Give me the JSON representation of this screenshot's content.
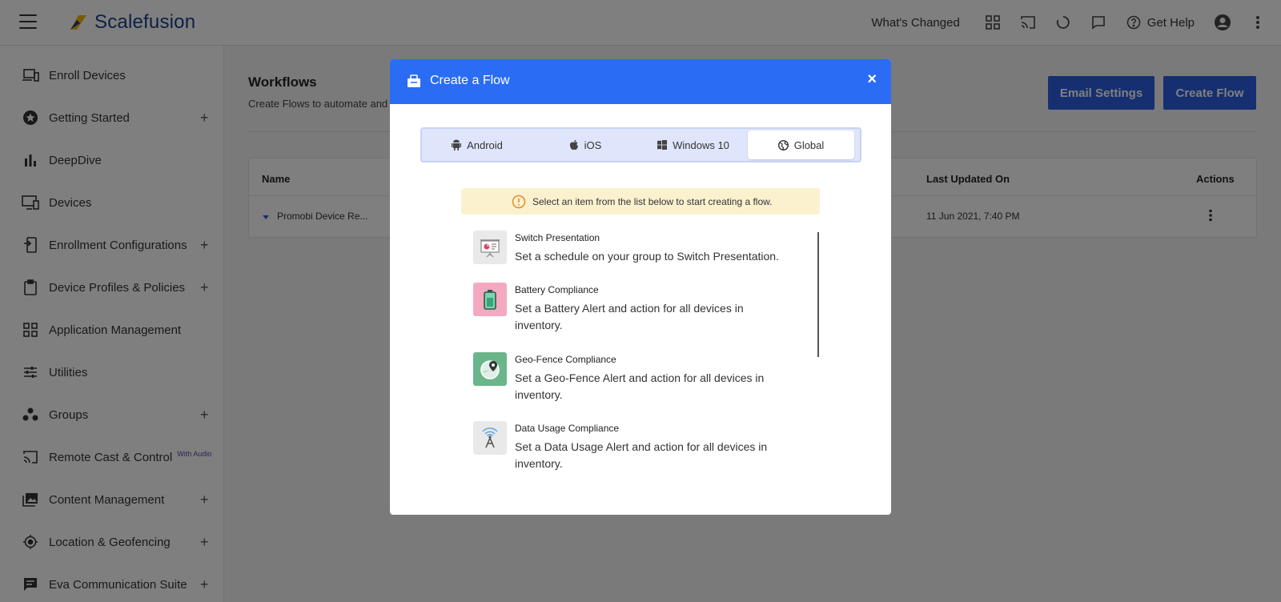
{
  "header": {
    "brand": "Scalefusion",
    "whats_changed": "What's Changed",
    "get_help": "Get Help"
  },
  "sidebar": {
    "items": [
      {
        "label": "Enroll Devices",
        "icon": "devices-icon",
        "expandable": false
      },
      {
        "label": "Getting Started",
        "icon": "star-icon",
        "expandable": true
      },
      {
        "label": "DeepDive",
        "icon": "bar-chart-icon",
        "expandable": false
      },
      {
        "label": "Devices",
        "icon": "monitor-icon",
        "expandable": false
      },
      {
        "label": "Enrollment Configurations",
        "icon": "phone-config-icon",
        "expandable": true
      },
      {
        "label": "Device Profiles & Policies",
        "icon": "clipboard-icon",
        "expandable": true
      },
      {
        "label": "Application Management",
        "icon": "apps-grid-icon",
        "expandable": false
      },
      {
        "label": "Utilities",
        "icon": "sliders-icon",
        "expandable": false
      },
      {
        "label": "Groups",
        "icon": "groups-icon",
        "expandable": true
      },
      {
        "label": "Remote Cast & Control",
        "icon": "cast-icon",
        "expandable": false,
        "sup": "With Audio"
      },
      {
        "label": "Content Management",
        "icon": "photo-library-icon",
        "expandable": true
      },
      {
        "label": "Location & Geofencing",
        "icon": "location-icon",
        "expandable": true
      },
      {
        "label": "Eva Communication Suite",
        "icon": "chat-icon",
        "expandable": true
      }
    ]
  },
  "main": {
    "title": "Workflows",
    "subtitle": "Create Flows to automate and s",
    "email_settings": "Email Settings",
    "create_flow": "Create Flow",
    "table": {
      "headers": {
        "name": "Name",
        "last_updated": "Last Updated On",
        "actions": "Actions"
      },
      "rows": [
        {
          "name": "Promobi Device Re...",
          "last_updated": "11 Jun 2021, 7:40 PM"
        }
      ]
    }
  },
  "modal": {
    "title": "Create a Flow",
    "close": "×",
    "tabs": [
      {
        "label": "Android",
        "icon": "android-icon"
      },
      {
        "label": "iOS",
        "icon": "apple-icon"
      },
      {
        "label": "Windows 10",
        "icon": "windows-icon"
      },
      {
        "label": "Global",
        "icon": "globe-icon",
        "active": true
      }
    ],
    "info": "Select an item from the list below to start creating a flow.",
    "flows": [
      {
        "title": "Switch Presentation",
        "desc": "Set a schedule on your group to Switch Presentation.",
        "icon": "presentation-icon",
        "bg": "#e9e9e9"
      },
      {
        "title": "Battery Compliance",
        "desc": "Set a Battery Alert and action for all devices in inventory.",
        "icon": "battery-icon",
        "bg": "#f5a9c0"
      },
      {
        "title": "Geo-Fence Compliance",
        "desc": "Set a Geo-Fence Alert and action for all devices in inventory.",
        "icon": "geofence-icon",
        "bg": "#6bb58a"
      },
      {
        "title": "Data Usage Compliance",
        "desc": "Set a Data Usage Alert and action for all devices in inventory.",
        "icon": "antenna-icon",
        "bg": "#e9e9e9"
      }
    ]
  },
  "colors": {
    "brand": "#1c3f8c",
    "primary": "#2a5fe0",
    "modal_header": "#2a6df4",
    "info_bg": "#fbf1ce"
  }
}
